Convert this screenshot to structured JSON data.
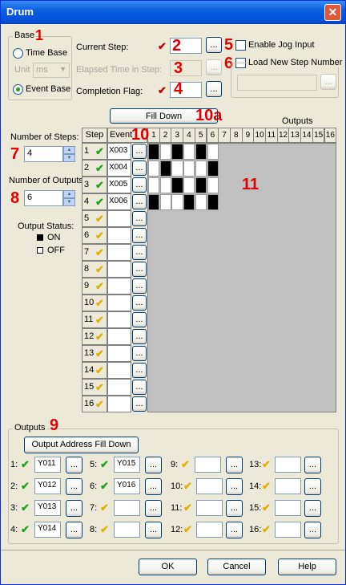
{
  "window": {
    "title": "Drum",
    "close_label": "✕"
  },
  "base": {
    "group_title": "Base",
    "time_base_label": "Time Base",
    "unit_label": "Unit",
    "unit_value": "ms",
    "event_base_label": "Event Base"
  },
  "step_fields": {
    "current_step_label": "Current Step:",
    "elapsed_time_label": "Elapsed Time in Step:",
    "completion_flag_label": "Completion Flag:",
    "browse_label": "..."
  },
  "options": {
    "enable_jog_label": "Enable Jog Input",
    "load_new_step_label": "Load New Step Number"
  },
  "callouts": [
    "1",
    "2",
    "3",
    "4",
    "5",
    "6",
    "7",
    "8",
    "9",
    "10",
    "10a",
    "11"
  ],
  "fill_down_label": "Fill Down",
  "outputs_header": "Outputs",
  "num_steps": {
    "label": "Number of Steps:",
    "value": "4"
  },
  "num_outputs": {
    "label": "Number of Outputs:",
    "value": "6"
  },
  "output_status": {
    "label": "Output Status:",
    "on_label": "ON",
    "off_label": "OFF"
  },
  "table": {
    "step_header": "Step",
    "event_header": "Event",
    "output_columns": [
      "1",
      "2",
      "3",
      "4",
      "5",
      "6",
      "7",
      "8",
      "9",
      "10",
      "11",
      "12",
      "13",
      "14",
      "15",
      "16"
    ],
    "steps": [
      {
        "num": "1",
        "event": "X003",
        "status": "green"
      },
      {
        "num": "2",
        "event": "X004",
        "status": "green"
      },
      {
        "num": "3",
        "event": "X005",
        "status": "green"
      },
      {
        "num": "4",
        "event": "X006",
        "status": "green"
      },
      {
        "num": "5",
        "event": "",
        "status": "yellow"
      },
      {
        "num": "6",
        "event": "",
        "status": "yellow"
      },
      {
        "num": "7",
        "event": "",
        "status": "yellow"
      },
      {
        "num": "8",
        "event": "",
        "status": "yellow"
      },
      {
        "num": "9",
        "event": "",
        "status": "yellow"
      },
      {
        "num": "10",
        "event": "",
        "status": "yellow"
      },
      {
        "num": "11",
        "event": "",
        "status": "yellow"
      },
      {
        "num": "12",
        "event": "",
        "status": "yellow"
      },
      {
        "num": "13",
        "event": "",
        "status": "yellow"
      },
      {
        "num": "14",
        "event": "",
        "status": "yellow"
      },
      {
        "num": "15",
        "event": "",
        "status": "yellow"
      },
      {
        "num": "16",
        "event": "",
        "status": "yellow"
      }
    ],
    "matrix": [
      [
        1,
        0,
        1,
        0,
        1,
        0
      ],
      [
        0,
        1,
        0,
        0,
        0,
        1
      ],
      [
        0,
        0,
        1,
        0,
        1,
        0
      ],
      [
        1,
        0,
        0,
        1,
        0,
        1
      ]
    ]
  },
  "outputs_group": {
    "title": "Outputs",
    "fill_down_label": "Output Address Fill Down",
    "items": [
      {
        "num": "1:",
        "value": "Y011",
        "status": "green"
      },
      {
        "num": "2:",
        "value": "Y012",
        "status": "green"
      },
      {
        "num": "3:",
        "value": "Y013",
        "status": "green"
      },
      {
        "num": "4:",
        "value": "Y014",
        "status": "green"
      },
      {
        "num": "5:",
        "value": "Y015",
        "status": "green"
      },
      {
        "num": "6:",
        "value": "Y016",
        "status": "green"
      },
      {
        "num": "7:",
        "value": "",
        "status": "yellow"
      },
      {
        "num": "8:",
        "value": "",
        "status": "yellow"
      },
      {
        "num": "9:",
        "value": "",
        "status": "yellow"
      },
      {
        "num": "10:",
        "value": "",
        "status": "yellow"
      },
      {
        "num": "11:",
        "value": "",
        "status": "yellow"
      },
      {
        "num": "12:",
        "value": "",
        "status": "yellow"
      },
      {
        "num": "13:",
        "value": "",
        "status": "yellow"
      },
      {
        "num": "14:",
        "value": "",
        "status": "yellow"
      },
      {
        "num": "15:",
        "value": "",
        "status": "yellow"
      },
      {
        "num": "16:",
        "value": "",
        "status": "yellow"
      }
    ]
  },
  "footer": {
    "ok_label": "OK",
    "cancel_label": "Cancel",
    "help_label": "Help"
  },
  "colors": {
    "title_bar": "#0a5fe0",
    "callout": "#e00000",
    "check_green": "#21a121",
    "check_yellow": "#e0b000",
    "grid_gray": "#c0c0c0"
  }
}
